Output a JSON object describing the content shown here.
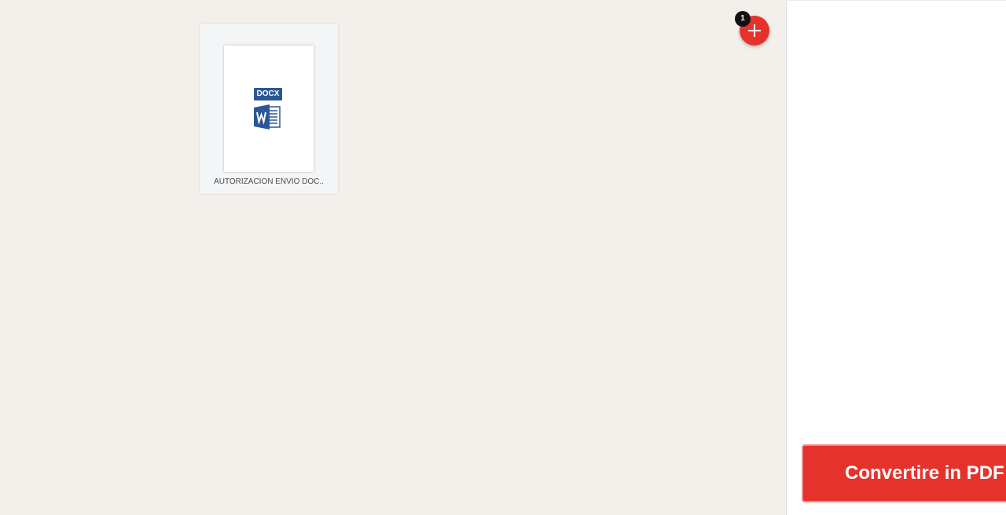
{
  "files": [
    {
      "type_badge": "DOCX",
      "name": "AUTORIZACIÓN ENVIO DOC..",
      "icon": "word-document-icon"
    }
  ],
  "add_button": {
    "icon": "plus-icon",
    "count": "1"
  },
  "sidebar": {
    "convert_label": "Convertire in PDF"
  },
  "colors": {
    "accent": "#e5322d",
    "workspace_bg": "#f3efea",
    "word_blue": "#2b5797"
  }
}
